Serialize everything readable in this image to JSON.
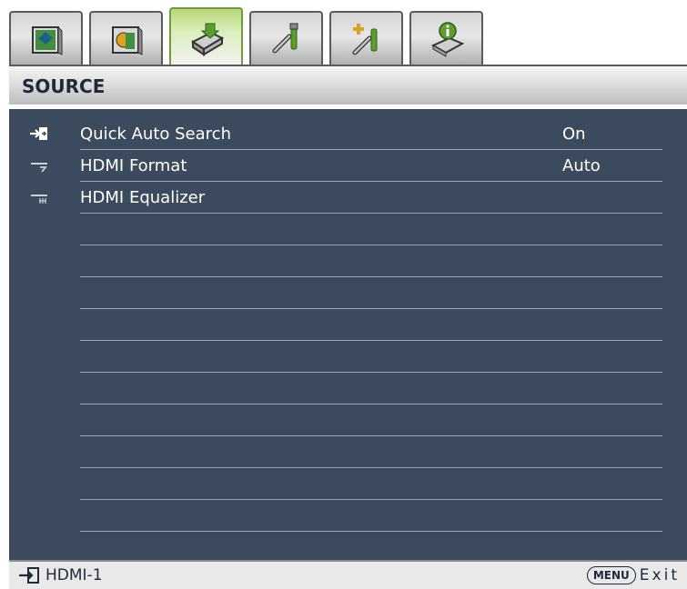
{
  "tabs": [
    {
      "icon": "display-settings-icon",
      "active": false
    },
    {
      "icon": "picture-settings-icon",
      "active": false
    },
    {
      "icon": "source-projector-icon",
      "active": true
    },
    {
      "icon": "system-setup-basic-icon",
      "active": false
    },
    {
      "icon": "system-setup-advanced-icon",
      "active": false
    },
    {
      "icon": "information-icon",
      "active": false
    }
  ],
  "menu": {
    "title": "SOURCE",
    "items": [
      {
        "label": "Quick Auto Search",
        "value": "On",
        "icon": "input-arrow-icon"
      },
      {
        "label": "HDMI Format",
        "value": "Auto",
        "icon": "hdmi-format-icon"
      },
      {
        "label": "HDMI Equalizer",
        "value": "",
        "icon": "hdmi-equalizer-icon"
      }
    ],
    "empty_rows": 10
  },
  "status": {
    "source": "HDMI-1",
    "menu_key": "MENU",
    "exit_label": "Exit"
  },
  "colors": {
    "menu_background": "#3b4a5c",
    "active_tab": "#b7d878",
    "text": "#ffffff"
  }
}
